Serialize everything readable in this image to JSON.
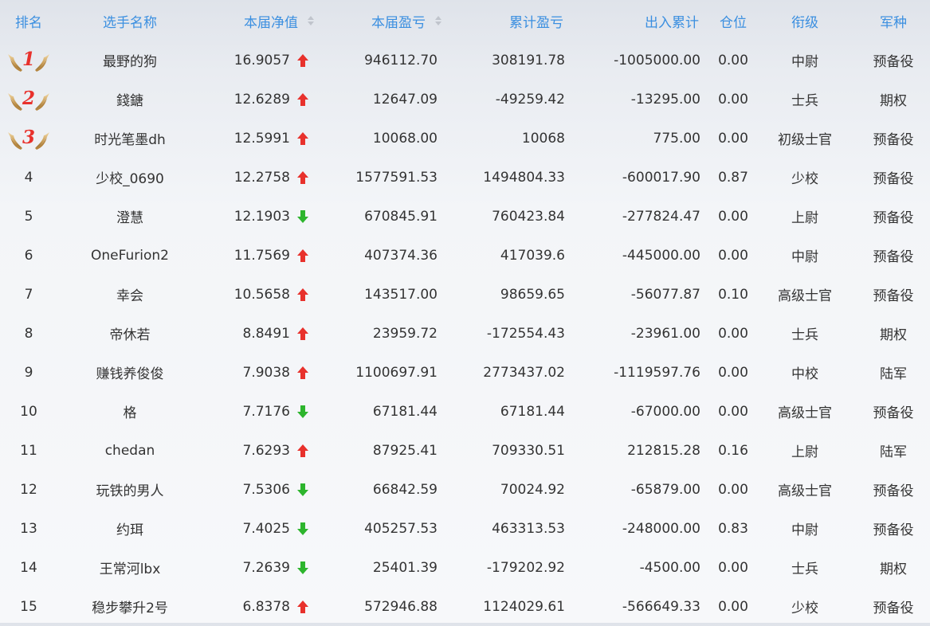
{
  "header": {
    "rank": "排名",
    "name": "选手名称",
    "nav": "本届净值",
    "profit": "本届盈亏",
    "cumulative": "累计盈亏",
    "flow": "出入累计",
    "position": "仓位",
    "title_rank": "衔级",
    "branch": "军种"
  },
  "colors": {
    "header_text": "#3b8fe0",
    "up": "#e8312c",
    "down": "#2db52d",
    "medal_number": "#e8312c"
  },
  "rows": [
    {
      "rank": "1",
      "medal": true,
      "name": "最野的狗",
      "nav": "16.9057",
      "trend": "up",
      "profit": "946112.70",
      "cumulative": "308191.78",
      "flow": "-1005000.00",
      "position": "0.00",
      "title_rank": "中尉",
      "branch": "预备役"
    },
    {
      "rank": "2",
      "medal": true,
      "name": "錢鎕",
      "nav": "12.6289",
      "trend": "up",
      "profit": "12647.09",
      "cumulative": "-49259.42",
      "flow": "-13295.00",
      "position": "0.00",
      "title_rank": "士兵",
      "branch": "期权"
    },
    {
      "rank": "3",
      "medal": true,
      "name": "时光笔墨dh",
      "nav": "12.5991",
      "trend": "up",
      "profit": "10068.00",
      "cumulative": "10068",
      "flow": "775.00",
      "position": "0.00",
      "title_rank": "初级士官",
      "branch": "预备役"
    },
    {
      "rank": "4",
      "medal": false,
      "name": "少校_0690",
      "nav": "12.2758",
      "trend": "up",
      "profit": "1577591.53",
      "cumulative": "1494804.33",
      "flow": "-600017.90",
      "position": "0.87",
      "title_rank": "少校",
      "branch": "预备役"
    },
    {
      "rank": "5",
      "medal": false,
      "name": "澄慧",
      "nav": "12.1903",
      "trend": "down",
      "profit": "670845.91",
      "cumulative": "760423.84",
      "flow": "-277824.47",
      "position": "0.00",
      "title_rank": "上尉",
      "branch": "预备役"
    },
    {
      "rank": "6",
      "medal": false,
      "name": "OneFurion2",
      "nav": "11.7569",
      "trend": "up",
      "profit": "407374.36",
      "cumulative": "417039.6",
      "flow": "-445000.00",
      "position": "0.00",
      "title_rank": "中尉",
      "branch": "预备役"
    },
    {
      "rank": "7",
      "medal": false,
      "name": "幸会",
      "nav": "10.5658",
      "trend": "up",
      "profit": "143517.00",
      "cumulative": "98659.65",
      "flow": "-56077.87",
      "position": "0.10",
      "title_rank": "高级士官",
      "branch": "预备役"
    },
    {
      "rank": "8",
      "medal": false,
      "name": "帝休若",
      "nav": "8.8491",
      "trend": "up",
      "profit": "23959.72",
      "cumulative": "-172554.43",
      "flow": "-23961.00",
      "position": "0.00",
      "title_rank": "士兵",
      "branch": "期权"
    },
    {
      "rank": "9",
      "medal": false,
      "name": "赚钱养俊俊",
      "nav": "7.9038",
      "trend": "up",
      "profit": "1100697.91",
      "cumulative": "2773437.02",
      "flow": "-1119597.76",
      "position": "0.00",
      "title_rank": "中校",
      "branch": "陆军"
    },
    {
      "rank": "10",
      "medal": false,
      "name": "格",
      "nav": "7.7176",
      "trend": "down",
      "profit": "67181.44",
      "cumulative": "67181.44",
      "flow": "-67000.00",
      "position": "0.00",
      "title_rank": "高级士官",
      "branch": "预备役"
    },
    {
      "rank": "11",
      "medal": false,
      "name": "chedan",
      "nav": "7.6293",
      "trend": "up",
      "profit": "87925.41",
      "cumulative": "709330.51",
      "flow": "212815.28",
      "position": "0.16",
      "title_rank": "上尉",
      "branch": "陆军"
    },
    {
      "rank": "12",
      "medal": false,
      "name": "玩铁的男人",
      "nav": "7.5306",
      "trend": "down",
      "profit": "66842.59",
      "cumulative": "70024.92",
      "flow": "-65879.00",
      "position": "0.00",
      "title_rank": "高级士官",
      "branch": "预备役"
    },
    {
      "rank": "13",
      "medal": false,
      "name": "约珥",
      "nav": "7.4025",
      "trend": "down",
      "profit": "405257.53",
      "cumulative": "463313.53",
      "flow": "-248000.00",
      "position": "0.83",
      "title_rank": "中尉",
      "branch": "预备役"
    },
    {
      "rank": "14",
      "medal": false,
      "name": "王常河lbx",
      "nav": "7.2639",
      "trend": "down",
      "profit": "25401.39",
      "cumulative": "-179202.92",
      "flow": "-4500.00",
      "position": "0.00",
      "title_rank": "士兵",
      "branch": "期权"
    },
    {
      "rank": "15",
      "medal": false,
      "name": "稳步攀升2号",
      "nav": "6.8378",
      "trend": "up",
      "profit": "572946.88",
      "cumulative": "1124029.61",
      "flow": "-566649.33",
      "position": "0.00",
      "title_rank": "少校",
      "branch": "预备役"
    }
  ]
}
